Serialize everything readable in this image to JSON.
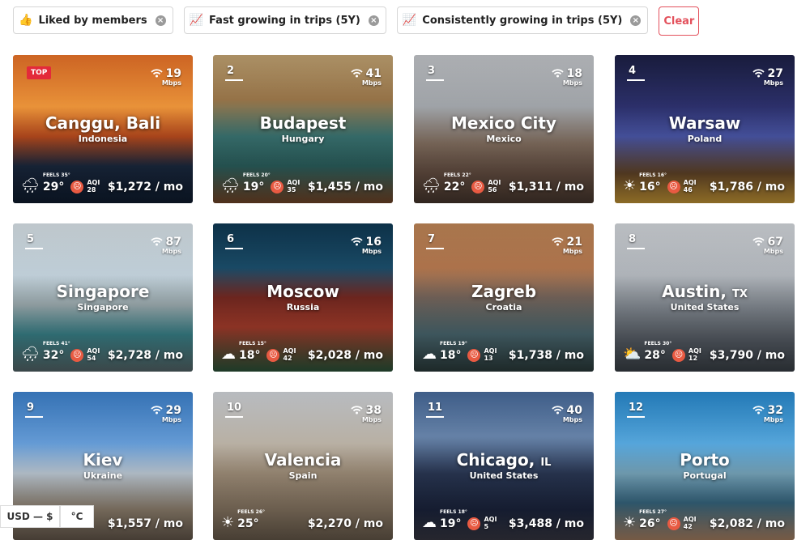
{
  "filters": [
    {
      "emoji": "👍",
      "label": "Liked by members"
    },
    {
      "emoji": "📈",
      "label": "Fast growing in trips (5Y)"
    },
    {
      "emoji": "📈",
      "label": "Consistently growing in trips (5Y)"
    }
  ],
  "clear_label": "Clear",
  "cards": [
    {
      "rank": "",
      "badge": "TOP",
      "wifi": "19",
      "wifi_unit": "Mbps",
      "city": "Canggu, Bali",
      "state": "",
      "country": "Indonesia",
      "weather": "rain-cloud-icon",
      "weather_glyph": "🌧",
      "feels": "FEELS 35°",
      "temp": "29°",
      "aqi_label": "AQI",
      "aqi": "28",
      "price": "$1,272 / mo",
      "bg": "linear-gradient(180deg,#f0762a 0%,#f59a3c 35%,#c34f1f 55%,#1d2c44 75%,#0f1d31 100%)"
    },
    {
      "rank": "2",
      "badge": "",
      "wifi": "41",
      "wifi_unit": "Mbps",
      "city": "Budapest",
      "state": "",
      "country": "Hungary",
      "weather": "rain-cloud-icon",
      "weather_glyph": "🌧",
      "feels": "FEELS 20°",
      "temp": "19°",
      "aqi_label": "AQI",
      "aqi": "35",
      "price": "$1,455 / mo",
      "bg": "linear-gradient(180deg,#c8a876 0%,#9f7a4c 30%,#3d7a78 55%,#2f6866 75%,#7a4a2a 100%)"
    },
    {
      "rank": "3",
      "badge": "",
      "wifi": "18",
      "wifi_unit": "Mbps",
      "city": "Mexico City",
      "state": "",
      "country": "Mexico",
      "weather": "rain-cloud-icon",
      "weather_glyph": "🌧",
      "feels": "FEELS 22°",
      "temp": "22°",
      "aqi_label": "AQI",
      "aqi": "56",
      "price": "$1,311 / mo",
      "bg": "linear-gradient(180deg,#c9ccd0 0%,#a7abb0 35%,#8a7565 60%,#6b5346 80%,#4b3a30 100%)"
    },
    {
      "rank": "4",
      "badge": "",
      "wifi": "27",
      "wifi_unit": "Mbps",
      "city": "Warsaw",
      "state": "",
      "country": "Poland",
      "weather": "sun-icon",
      "weather_glyph": "☀",
      "feels": "FEELS 16°",
      "temp": "16°",
      "aqi_label": "AQI",
      "aqi": "46",
      "price": "$1,786 / mo",
      "bg": "linear-gradient(180deg,#1d2147 0%,#2e3270 35%,#4e5bb0 55%,#6a4a2a 80%,#d6a33a 100%)"
    },
    {
      "rank": "5",
      "badge": "",
      "wifi": "87",
      "wifi_unit": "Mbps",
      "city": "Singapore",
      "state": "",
      "country": "Singapore",
      "weather": "rain-cloud-icon",
      "weather_glyph": "🌧",
      "feels": "FEELS 41°",
      "temp": "32°",
      "aqi_label": "AQI",
      "aqi": "54",
      "price": "$2,728 / mo",
      "bg": "linear-gradient(180deg,#dfe9ef 0%,#c8d8e2 35%,#a4b4b8 55%,#3d8b93 75%,#5a6d70 100%)"
    },
    {
      "rank": "6",
      "badge": "",
      "wifi": "16",
      "wifi_unit": "Mbps",
      "city": "Moscow",
      "state": "",
      "country": "Russia",
      "weather": "cloud-icon",
      "weather_glyph": "☁",
      "feels": "FEELS 15°",
      "temp": "18°",
      "aqi_label": "AQI",
      "aqi": "42",
      "price": "$2,028 / mo",
      "bg": "linear-gradient(180deg,#0f3a55 0%,#1b4e6b 30%,#7a2a22 50%,#b0402e 70%,#2d5a3d 100%)"
    },
    {
      "rank": "7",
      "badge": "",
      "wifi": "21",
      "wifi_unit": "Mbps",
      "city": "Zagreb",
      "state": "",
      "country": "Croatia",
      "weather": "cloud-icon",
      "weather_glyph": "☁",
      "feels": "FEELS 19°",
      "temp": "18°",
      "aqi_label": "AQI",
      "aqi": "13",
      "price": "$1,738 / mo",
      "bg": "linear-gradient(180deg,#c58a5a 0%,#b87a50 30%,#7b6a60 50%,#4f6f78 75%,#2d3e3e 100%)"
    },
    {
      "rank": "8",
      "badge": "",
      "wifi": "67",
      "wifi_unit": "Mbps",
      "city": "Austin,",
      "state": "TX",
      "country": "United States",
      "weather": "partly-cloudy-icon",
      "weather_glyph": "⛅",
      "feels": "FEELS 30°",
      "temp": "28°",
      "aqi_label": "AQI",
      "aqi": "12",
      "price": "$3,790 / mo",
      "bg": "linear-gradient(180deg,#d9dde2 0%,#b7bcc2 35%,#8b929a 55%,#5a616a 80%,#3d444b 100%)"
    },
    {
      "rank": "9",
      "badge": "",
      "wifi": "29",
      "wifi_unit": "Mbps",
      "city": "Kiev",
      "state": "",
      "country": "Ukraine",
      "weather": "cloud-icon",
      "weather_glyph": "☁",
      "feels": "",
      "temp": "",
      "aqi_label": "",
      "aqi": "",
      "price": "$1,557 / mo",
      "bg": "linear-gradient(180deg,#3f86d4 0%,#6aa3e0 35%,#c9d6e2 55%,#9a8a76 80%,#6a5d50 100%)"
    },
    {
      "rank": "10",
      "badge": "",
      "wifi": "38",
      "wifi_unit": "Mbps",
      "city": "Valencia",
      "state": "",
      "country": "Spain",
      "weather": "sun-icon",
      "weather_glyph": "☀",
      "feels": "FEELS 26°",
      "temp": "25°",
      "aqi_label": "AQI",
      "aqi": "",
      "price": "$2,270 / mo",
      "bg": "linear-gradient(180deg,#d7dbe0 0%,#c2b9ac 35%,#a89680 55%,#8f7d68 80%,#6e6050 100%)"
    },
    {
      "rank": "11",
      "badge": "",
      "wifi": "40",
      "wifi_unit": "Mbps",
      "city": "Chicago,",
      "state": "IL",
      "country": "United States",
      "weather": "cloud-icon",
      "weather_glyph": "☁",
      "feels": "FEELS 18°",
      "temp": "19°",
      "aqi_label": "AQI",
      "aqi": "5",
      "price": "$3,488 / mo",
      "bg": "linear-gradient(180deg,#4a6ea0 0%,#6c8ab2 30%,#2c3a58 55%,#1c2640 80%,#3a3a46 100%)"
    },
    {
      "rank": "12",
      "badge": "",
      "wifi": "32",
      "wifi_unit": "Mbps",
      "city": "Porto",
      "state": "",
      "country": "Portugal",
      "weather": "sun-icon",
      "weather_glyph": "☀",
      "feels": "FEELS 27°",
      "temp": "26°",
      "aqi_label": "AQI",
      "aqi": "42",
      "price": "$2,082 / mo",
      "bg": "linear-gradient(180deg,#2a8fd6 0%,#5aaee6 35%,#7fb0c8 55%,#3b6f8a 75%,#b48a6a 100%)"
    }
  ],
  "footer": {
    "currency": "USD — $",
    "temperature_unit": "°C"
  }
}
